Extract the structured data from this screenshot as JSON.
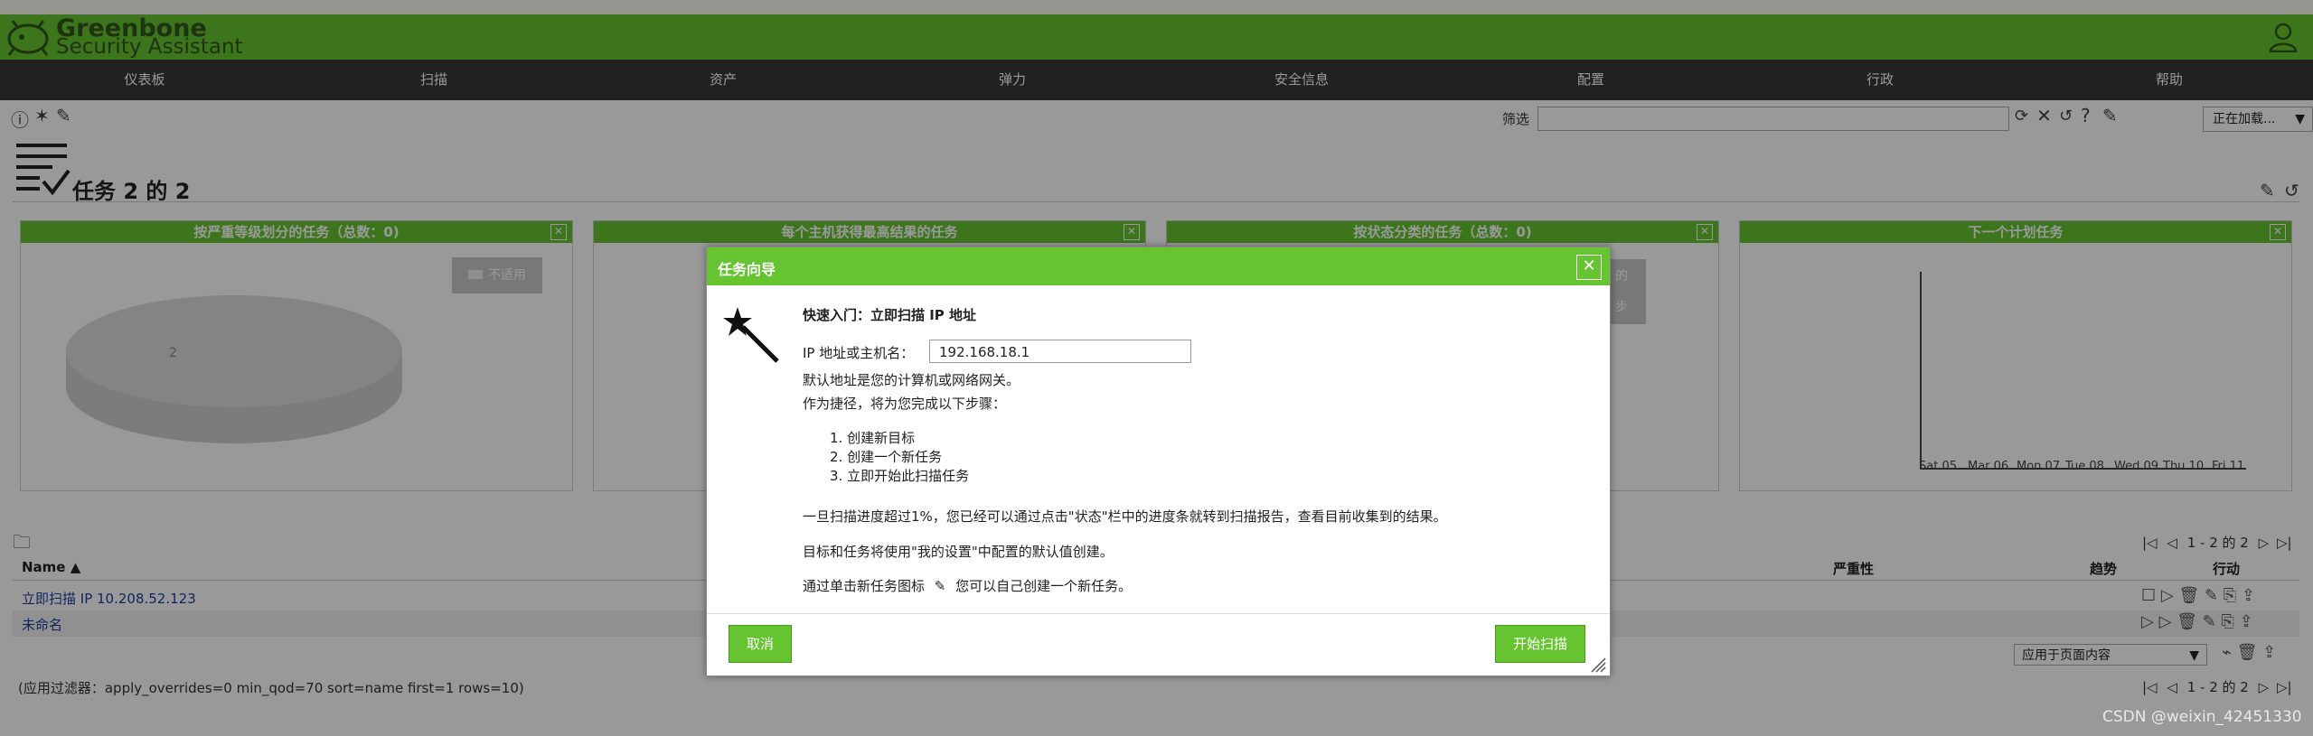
{
  "header": {
    "logo_line1": "Greenbone",
    "logo_line2": "Security Assistant",
    "brand_color": "#66c430"
  },
  "menu": {
    "items": [
      "仪表板",
      "扫描",
      "资产",
      "弹力",
      "安全信息",
      "配置",
      "行政",
      "帮助"
    ]
  },
  "toolbar": {
    "filter_label": "筛选",
    "filter_value": "",
    "filter_select": "正在加载..."
  },
  "page": {
    "title": "任务 2 的 2"
  },
  "panels": [
    {
      "title": "按严重等级划分的任务（总数：0)",
      "legend": "不适用",
      "pie_label": "2"
    },
    {
      "title": "每个主机获得最高结果的任务",
      "partial_legend": ""
    },
    {
      "title": "按状态分类的任务（总数：0)",
      "partial_legend_1": "的",
      "partial_legend_2": "步"
    },
    {
      "title": "下一个计划任务",
      "ticks": [
        "Sat 05",
        "Mar 06",
        "Mon 07",
        "Tue 08",
        "Wed 09",
        "Thu 10",
        "Fri 11"
      ]
    }
  ],
  "table": {
    "pagination": "1 - 2 的 2",
    "columns": {
      "name": "Name ▲",
      "severity": "严重性",
      "trend": "趋势",
      "actions": "行动"
    },
    "rows": [
      {
        "name": "立即扫描 IP 10.208.52.123"
      },
      {
        "name": "未命名"
      }
    ],
    "bulk_select": "应用于页面内容",
    "applied_filter": "(应用过滤器：apply_overrides=0 min_qod=70 sort=name first=1 rows=10)"
  },
  "dialog": {
    "title": "任务向导",
    "heading": "快速入门：立即扫描 IP 地址",
    "ip_label": "IP 地址或主机名：",
    "ip_value": "192.168.18.1",
    "default_note": "默认地址是您的计算机或网络网关。",
    "shortcut_note": "作为捷径，将为您完成以下步骤：",
    "steps": [
      "1. 创建新目标",
      "2. 创建一个新任务",
      "3. 立即开始此扫描任务"
    ],
    "progress_note": "一旦扫描进度超过1%，您已经可以通过点击\"状态\"栏中的进度条就转到扫描报告，查看目前收集到的结果。",
    "settings_note": "目标和任务将使用\"我的设置\"中配置的默认值创建。",
    "manual_note_a": "通过单击新任务图标",
    "manual_note_b": "您可以自己创建一个新任务。",
    "cancel_label": "取消",
    "start_label": "开始扫描"
  },
  "watermark": "CSDN @weixin_42451330"
}
